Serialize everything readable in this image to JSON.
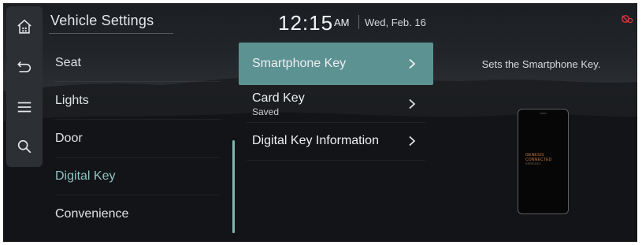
{
  "header": {
    "title": "Vehicle Settings",
    "time": "12:15",
    "ampm": "AM",
    "date": "Wed, Feb. 16"
  },
  "rail": {
    "icons": [
      "home-icon",
      "back-icon",
      "menu-icon",
      "search-icon"
    ]
  },
  "status": {
    "icon": "connectivity-status-icon",
    "color": "#d93a3a"
  },
  "menu": {
    "items": [
      {
        "label": "Seat"
      },
      {
        "label": "Lights"
      },
      {
        "label": "Door"
      },
      {
        "label": "Digital Key",
        "selected": true
      },
      {
        "label": "Convenience"
      }
    ]
  },
  "submenu": {
    "items": [
      {
        "label": "Smartphone Key",
        "highlighted": true
      },
      {
        "label": "Card Key",
        "sublabel": "Saved"
      },
      {
        "label": "Digital Key Information"
      }
    ]
  },
  "detail": {
    "description": "Sets the Smartphone Key.",
    "phone_logo_line1": "GENESIS",
    "phone_logo_line2": "CONNECTED",
    "phone_logo_line3": "SERVICES"
  },
  "colors": {
    "accent": "#5d9293",
    "selected_text": "#8fc3c3",
    "scrollbar": "#7fb5b3"
  }
}
